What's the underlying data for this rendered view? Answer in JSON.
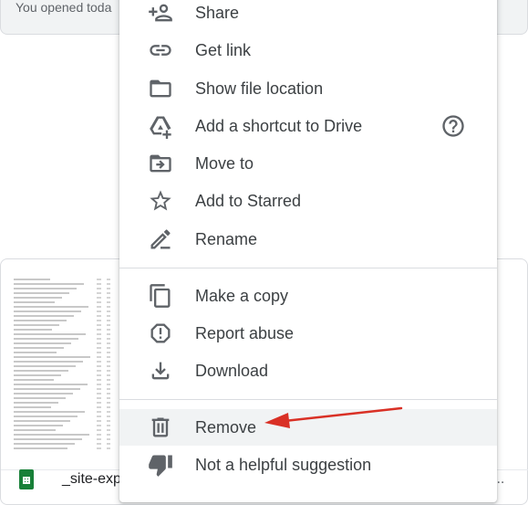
{
  "background": {
    "recent_text": "You opened toda",
    "file_name": "_site-exp",
    "file_trailing": "..."
  },
  "menu": {
    "items": [
      {
        "label": "Share",
        "icon": "person-add-icon"
      },
      {
        "label": "Get link",
        "icon": "link-icon"
      },
      {
        "label": "Show file location",
        "icon": "folder-icon"
      },
      {
        "label": "Add a shortcut to Drive",
        "icon": "add-shortcut-icon"
      },
      {
        "label": "Move to",
        "icon": "move-to-folder-icon"
      },
      {
        "label": "Add to Starred",
        "icon": "star-icon"
      },
      {
        "label": "Rename",
        "icon": "pencil-icon"
      },
      {
        "label": "Make a copy",
        "icon": "copy-icon"
      },
      {
        "label": "Report abuse",
        "icon": "report-icon"
      },
      {
        "label": "Download",
        "icon": "download-icon"
      },
      {
        "label": "Remove",
        "icon": "trash-icon"
      },
      {
        "label": "Not a helpful suggestion",
        "icon": "thumbs-down-icon"
      }
    ],
    "help_icon": "help-circle-icon"
  },
  "annotation": {
    "color": "#d93025"
  },
  "theme": {
    "icon_color": "#5f6368",
    "hover_bg": "#f1f3f4",
    "sheets_green": "#188038"
  }
}
